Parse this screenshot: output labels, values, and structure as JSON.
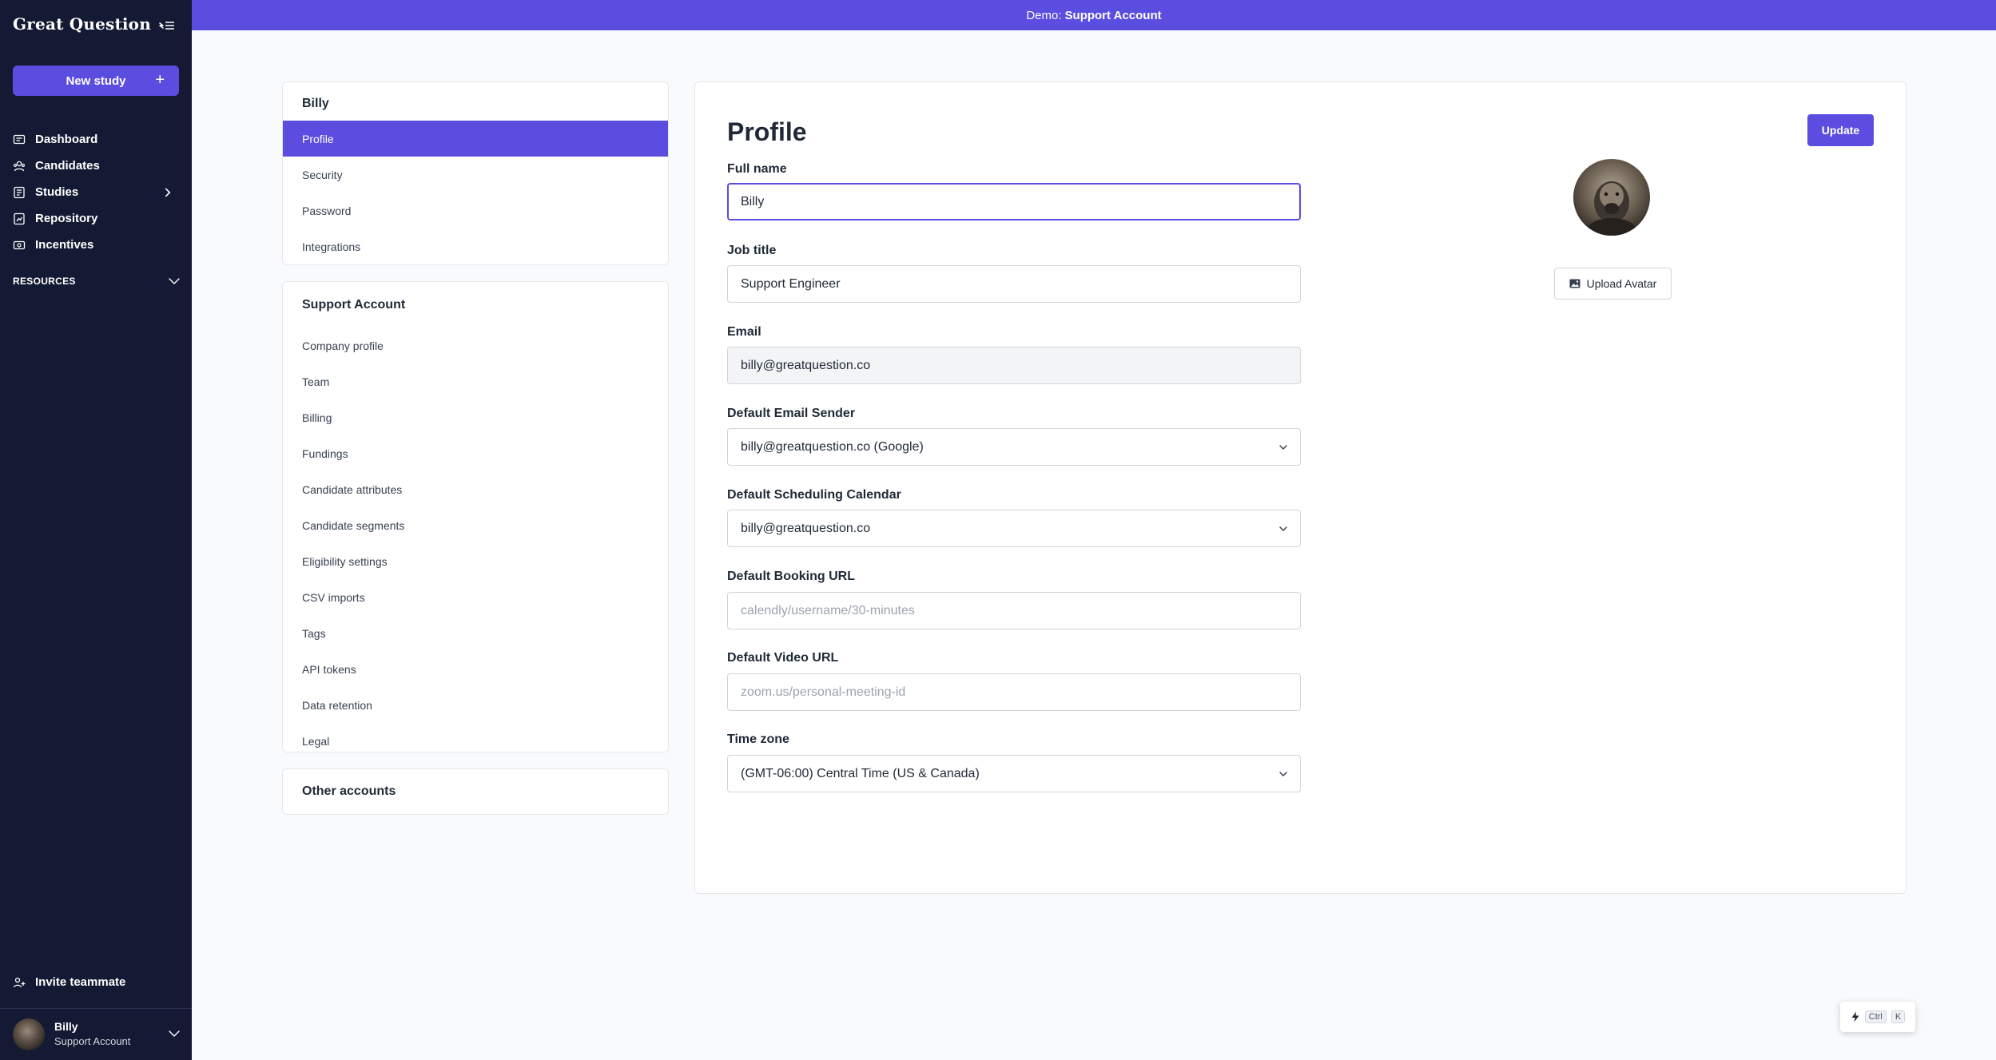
{
  "app": {
    "logo": "Great Question"
  },
  "banner": {
    "prefix": "Demo:",
    "account": "Support Account"
  },
  "sidebar": {
    "new_study_label": "New study",
    "items": [
      {
        "label": "Dashboard",
        "icon": "dashboard-icon"
      },
      {
        "label": "Candidates",
        "icon": "candidates-icon"
      },
      {
        "label": "Studies",
        "icon": "studies-icon"
      },
      {
        "label": "Repository",
        "icon": "repository-icon"
      },
      {
        "label": "Incentives",
        "icon": "incentives-icon"
      }
    ],
    "resources_label": "RESOURCES",
    "invite_label": "Invite teammate",
    "user": {
      "name": "Billy",
      "org": "Support Account"
    }
  },
  "settings_nav": {
    "personal": {
      "title": "Billy",
      "items": [
        "Profile",
        "Security",
        "Password",
        "Integrations"
      ],
      "active": "Profile"
    },
    "account": {
      "title": "Support Account",
      "items": [
        "Company profile",
        "Team",
        "Billing",
        "Fundings",
        "Candidate attributes",
        "Candidate segments",
        "Eligibility settings",
        "CSV imports",
        "Tags",
        "API tokens",
        "Data retention",
        "Legal"
      ]
    },
    "other": {
      "title": "Other accounts"
    }
  },
  "profile": {
    "title": "Profile",
    "update_label": "Update",
    "upload_avatar_label": "Upload Avatar",
    "fields": {
      "full_name": {
        "label": "Full name",
        "value": "Billy"
      },
      "job_title": {
        "label": "Job title",
        "value": "Support Engineer"
      },
      "email": {
        "label": "Email",
        "value": "billy@greatquestion.co"
      },
      "email_sender": {
        "label": "Default Email Sender",
        "value": "billy@greatquestion.co (Google)"
      },
      "scheduling_calendar": {
        "label": "Default Scheduling Calendar",
        "value": "billy@greatquestion.co"
      },
      "booking_url": {
        "label": "Default Booking URL",
        "placeholder": "calendly/username/30-minutes"
      },
      "video_url": {
        "label": "Default Video URL",
        "placeholder": "zoom.us/personal-meeting-id"
      },
      "time_zone": {
        "label": "Time zone",
        "value": "(GMT-06:00) Central Time (US & Canada)"
      }
    }
  },
  "command_palette": {
    "key1": "Ctrl",
    "key2": "K"
  },
  "colors": {
    "brand": "#5b4de0",
    "sidebar_bg": "#141a33",
    "page_bg": "#f9fafb"
  }
}
